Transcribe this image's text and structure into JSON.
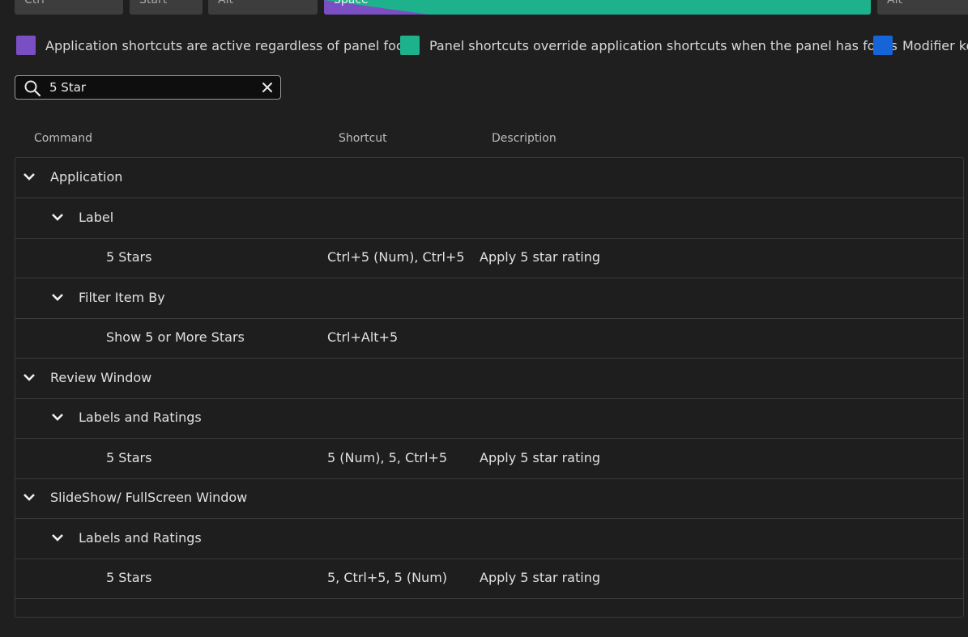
{
  "keyboard": {
    "keys": [
      {
        "label": "Ctrl"
      },
      {
        "label": "Start"
      },
      {
        "label": "Alt"
      },
      {
        "label": "Space"
      },
      {
        "label": "Alt"
      }
    ]
  },
  "legend": [
    {
      "color": "#7a4fc4",
      "text": "Application shortcuts are active regardless of panel focus"
    },
    {
      "color": "#1db28c",
      "text": "Panel shortcuts override application shortcuts when the panel has focus"
    },
    {
      "color": "#1565d8",
      "text": "Modifier keys"
    }
  ],
  "search": {
    "value": "5 Star",
    "icon": "search-icon",
    "clear_icon": "close-icon"
  },
  "columns": {
    "command": "Command",
    "shortcut": "Shortcut",
    "description": "Description"
  },
  "rows": [
    {
      "level": 0,
      "expanded": true,
      "command": "Application",
      "shortcut": "",
      "description": ""
    },
    {
      "level": 1,
      "expanded": true,
      "command": "Label",
      "shortcut": "",
      "description": ""
    },
    {
      "level": 2,
      "command": "5 Stars",
      "shortcut": "Ctrl+5 (Num), Ctrl+5",
      "description": "Apply 5 star rating"
    },
    {
      "level": 1,
      "expanded": true,
      "command": "Filter Item By",
      "shortcut": "",
      "description": ""
    },
    {
      "level": 2,
      "command": "Show 5 or More Stars",
      "shortcut": "Ctrl+Alt+5",
      "description": ""
    },
    {
      "level": 0,
      "expanded": true,
      "command": "Review Window",
      "shortcut": "",
      "description": ""
    },
    {
      "level": 1,
      "expanded": true,
      "command": "Labels and Ratings",
      "shortcut": "",
      "description": ""
    },
    {
      "level": 2,
      "command": "5 Stars",
      "shortcut": "5 (Num), 5, Ctrl+5",
      "description": "Apply 5 star rating"
    },
    {
      "level": 0,
      "expanded": true,
      "command": "SlideShow/ FullScreen Window",
      "shortcut": "",
      "description": ""
    },
    {
      "level": 1,
      "expanded": true,
      "command": "Labels and Ratings",
      "shortcut": "",
      "description": ""
    },
    {
      "level": 2,
      "command": "5 Stars",
      "shortcut": "5, Ctrl+5, 5 (Num)",
      "description": "Apply 5 star rating"
    }
  ]
}
